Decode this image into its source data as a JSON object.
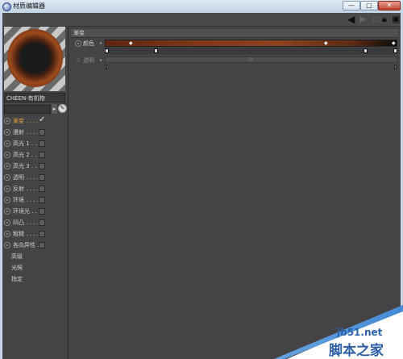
{
  "window": {
    "title": "材质编辑器",
    "buttons": {
      "minimize": "—",
      "maximize": "□",
      "close": "✕"
    }
  },
  "toolbar": {
    "icons": [
      "arrow-left-icon",
      "arrow-right-icon",
      "expand-icon",
      "lock-icon",
      "window-icon"
    ]
  },
  "material": {
    "name": "CHEEN-有机物"
  },
  "channels": [
    {
      "label": "漸变 . . . .",
      "checked": true,
      "active": true
    },
    {
      "label": "漫射 . . . .",
      "checked": false,
      "active": false
    },
    {
      "label": "高光 1 . . .",
      "checked": false,
      "active": false
    },
    {
      "label": "高光 2 . . .",
      "checked": false,
      "active": false
    },
    {
      "label": "高光 3 . . .",
      "checked": false,
      "active": false
    },
    {
      "label": "透明 . . . .",
      "checked": false,
      "active": false
    },
    {
      "label": "反射 . . . .",
      "checked": false,
      "active": false
    },
    {
      "label": "环境 . . . .",
      "checked": false,
      "active": false
    },
    {
      "label": "环境光 . . .",
      "checked": false,
      "active": false
    },
    {
      "label": "凹凸 . . . .",
      "checked": false,
      "active": false
    },
    {
      "label": "粗糙 . . . .",
      "checked": false,
      "active": false
    },
    {
      "label": "各向异性 . .",
      "checked": false,
      "active": false
    }
  ],
  "subitems": [
    "高级",
    "光照",
    "指定"
  ],
  "gradient_panel": {
    "section_title": "漸变",
    "color_label": "颜色",
    "alpha_label": "透明",
    "colors": {
      "dark_brown": "#5e2510",
      "mid_brown": "#8a4420",
      "end": "#0c0c0c"
    }
  },
  "watermark": {
    "site": "jb51.net",
    "name": "脚本之家"
  }
}
